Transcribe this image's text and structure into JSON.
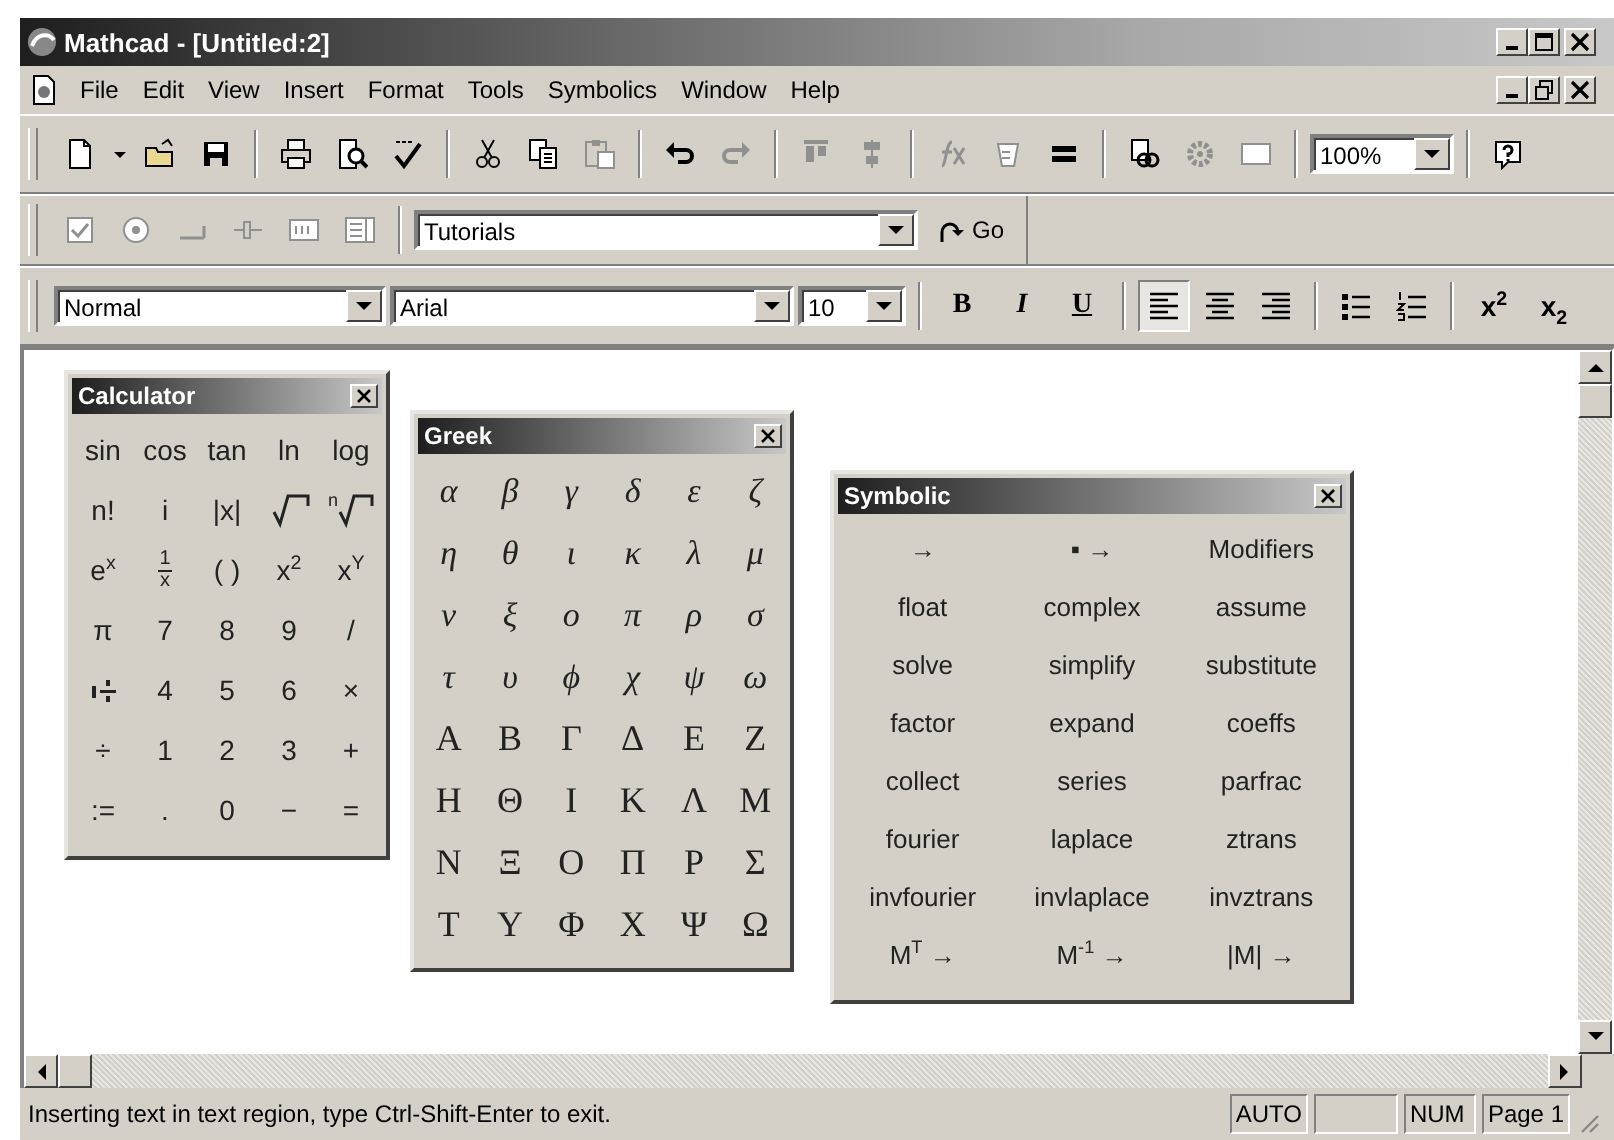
{
  "window": {
    "title": "Mathcad - [Untitled:2]"
  },
  "menu": [
    "File",
    "Edit",
    "View",
    "Insert",
    "Format",
    "Tools",
    "Symbolics",
    "Window",
    "Help"
  ],
  "standard_toolbar": [
    {
      "kind": "new",
      "disabled": false
    },
    {
      "kind": "dropdown",
      "disabled": false
    },
    {
      "kind": "open",
      "disabled": false
    },
    {
      "kind": "save",
      "disabled": false
    },
    {
      "kind": "separator"
    },
    {
      "kind": "print",
      "disabled": false
    },
    {
      "kind": "preview",
      "disabled": false
    },
    {
      "kind": "spell",
      "disabled": false
    },
    {
      "kind": "separator"
    },
    {
      "kind": "cut",
      "disabled": false
    },
    {
      "kind": "copy",
      "disabled": false
    },
    {
      "kind": "paste",
      "disabled": true
    },
    {
      "kind": "separator"
    },
    {
      "kind": "undo",
      "disabled": false
    },
    {
      "kind": "redo",
      "disabled": true
    },
    {
      "kind": "separator"
    },
    {
      "kind": "align-top",
      "disabled": true
    },
    {
      "kind": "align-down",
      "disabled": true
    },
    {
      "kind": "separator"
    },
    {
      "kind": "function",
      "disabled": true
    },
    {
      "kind": "unit",
      "disabled": true
    },
    {
      "kind": "equals",
      "disabled": false
    },
    {
      "kind": "separator"
    },
    {
      "kind": "link",
      "disabled": false
    },
    {
      "kind": "component",
      "disabled": true
    },
    {
      "kind": "region",
      "disabled": true
    },
    {
      "kind": "separator"
    },
    {
      "kind": "zoom-combo",
      "value": "100%"
    },
    {
      "kind": "separator"
    },
    {
      "kind": "help",
      "disabled": false
    }
  ],
  "controls_toolbar": [
    {
      "kind": "checkbox",
      "disabled": true
    },
    {
      "kind": "radio",
      "disabled": true
    },
    {
      "kind": "push",
      "disabled": true
    },
    {
      "kind": "slider",
      "disabled": true
    },
    {
      "kind": "textbox",
      "disabled": true
    },
    {
      "kind": "listbox",
      "disabled": true
    },
    {
      "kind": "separator"
    },
    {
      "kind": "resource-combo",
      "value": "Tutorials"
    },
    {
      "kind": "go",
      "label": "Go"
    }
  ],
  "formatting_toolbar": [
    {
      "kind": "style-combo",
      "value": "Normal"
    },
    {
      "kind": "font-combo",
      "value": "Arial"
    },
    {
      "kind": "size-combo",
      "value": "10"
    },
    {
      "kind": "separator"
    },
    {
      "kind": "bold",
      "label": "B"
    },
    {
      "kind": "italic",
      "label": "I"
    },
    {
      "kind": "underline",
      "label": "U"
    },
    {
      "kind": "separator"
    },
    {
      "kind": "align-left",
      "selected": true
    },
    {
      "kind": "align-center",
      "selected": false
    },
    {
      "kind": "align-right",
      "selected": false
    },
    {
      "kind": "separator"
    },
    {
      "kind": "bullets",
      "selected": false
    },
    {
      "kind": "numbering",
      "selected": false
    },
    {
      "kind": "separator"
    },
    {
      "kind": "superscript",
      "label": "x$^{2}$"
    },
    {
      "kind": "subscript",
      "label": "x$_{2}$"
    }
  ],
  "calculator": {
    "title": "Calculator",
    "buttons": [
      {
        "kind": "text",
        "label": "sin"
      },
      {
        "kind": "text",
        "label": "cos"
      },
      {
        "kind": "text",
        "label": "tan"
      },
      {
        "kind": "text",
        "label": "ln"
      },
      {
        "kind": "text",
        "label": "log"
      },
      {
        "kind": "text",
        "label": "n!"
      },
      {
        "kind": "text",
        "label": "i"
      },
      {
        "kind": "text",
        "label": "|x|"
      },
      {
        "kind": "sqrt"
      },
      {
        "kind": "nth-root",
        "label": "n"
      },
      {
        "kind": "text",
        "label": "e$^{x}$"
      },
      {
        "kind": "fraction",
        "numerator": "1",
        "denominator": "x"
      },
      {
        "kind": "text",
        "label": "( )"
      },
      {
        "kind": "text",
        "label": "x$^{2}$"
      },
      {
        "kind": "text",
        "label": "x$^{Y}$"
      },
      {
        "kind": "text",
        "label": "π"
      },
      {
        "kind": "text",
        "label": "7"
      },
      {
        "kind": "text",
        "label": "8"
      },
      {
        "kind": "text",
        "label": "9"
      },
      {
        "kind": "text",
        "label": "/"
      },
      {
        "kind": "mixed-number"
      },
      {
        "kind": "text",
        "label": "4"
      },
      {
        "kind": "text",
        "label": "5"
      },
      {
        "kind": "text",
        "label": "6"
      },
      {
        "kind": "text",
        "label": "×"
      },
      {
        "kind": "text",
        "label": "÷"
      },
      {
        "kind": "text",
        "label": "1"
      },
      {
        "kind": "text",
        "label": "2"
      },
      {
        "kind": "text",
        "label": "3"
      },
      {
        "kind": "text",
        "label": "+"
      },
      {
        "kind": "text",
        "label": ":="
      },
      {
        "kind": "text",
        "label": "."
      },
      {
        "kind": "text",
        "label": "0"
      },
      {
        "kind": "text",
        "label": "−"
      },
      {
        "kind": "text",
        "label": "="
      }
    ]
  },
  "greek": {
    "title": "Greek",
    "lowercase": [
      "α",
      "β",
      "γ",
      "δ",
      "ε",
      "ζ",
      "η",
      "θ",
      "ι",
      "κ",
      "λ",
      "μ",
      "ν",
      "ξ",
      "ο",
      "π",
      "ρ",
      "σ",
      "τ",
      "υ",
      "ϕ",
      "χ",
      "ψ",
      "ω"
    ],
    "uppercase": [
      "Α",
      "Β",
      "Γ",
      "Δ",
      "Ε",
      "Ζ",
      "Η",
      "Θ",
      "Ι",
      "Κ",
      "Λ",
      "Μ",
      "Ν",
      "Ξ",
      "Ο",
      "Π",
      "Ρ",
      "Σ",
      "Τ",
      "Υ",
      "Φ",
      "Χ",
      "Ψ",
      "Ω"
    ]
  },
  "symbolic": {
    "title": "Symbolic",
    "buttons": [
      "→",
      "▪ →",
      "Modifiers",
      "float",
      "complex",
      "assume",
      "solve",
      "simplify",
      "substitute",
      "factor",
      "expand",
      "coeffs",
      "collect",
      "series",
      "parfrac",
      "fourier",
      "laplace",
      "ztrans",
      "invfourier",
      "invlaplace",
      "invztrans",
      "M$^{T}$ →",
      "M$^{-1}$ →",
      "|M| →"
    ]
  },
  "status_bar": {
    "message": "Inserting text in text region, type Ctrl-Shift-Enter to exit.",
    "panes": [
      "AUTO",
      "NUM",
      "Page 1"
    ]
  }
}
